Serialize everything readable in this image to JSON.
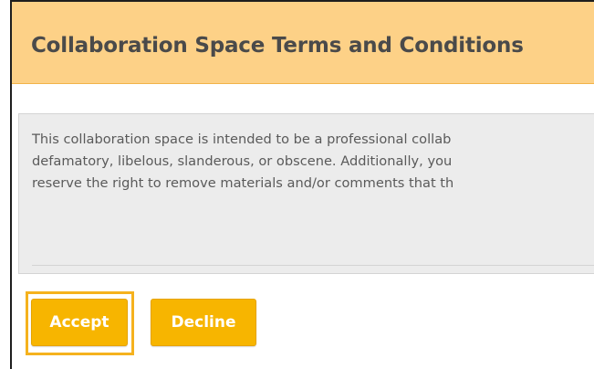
{
  "dialog": {
    "title": "Collaboration Space Terms and Conditions"
  },
  "terms": {
    "lines": [
      "This collaboration space is intended to be a professional collab",
      "defamatory, libelous, slanderous, or obscene. Additionally, you",
      "reserve the right to remove materials and/or comments that th"
    ]
  },
  "actions": {
    "accept_label": "Accept",
    "decline_label": "Decline"
  },
  "colors": {
    "header_bg": "#fdd187",
    "button_bg": "#f7b500",
    "focus_ring": "#f5b21e",
    "terms_bg": "#ececec"
  }
}
